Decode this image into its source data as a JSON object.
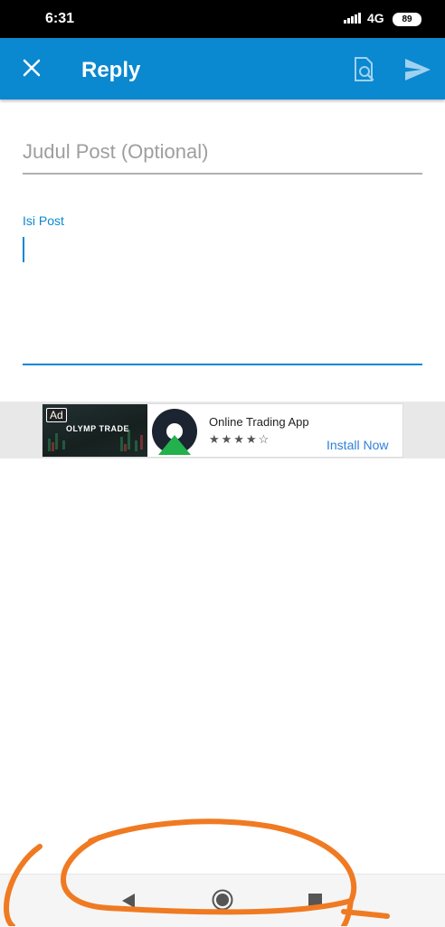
{
  "status_bar": {
    "time": "6:31",
    "network": "4G",
    "battery": "89"
  },
  "app_bar": {
    "title": "Reply",
    "close_icon": "close-icon",
    "preview_icon": "document-search-icon",
    "send_icon": "send-icon"
  },
  "form": {
    "title_placeholder": "Judul Post (Optional)",
    "title_value": "",
    "body_label": "Isi Post",
    "body_value": ""
  },
  "ad": {
    "badge": "Ad",
    "image_brand": "OLYMP TRADE",
    "app_name": "Online Trading App",
    "stars": "★★★★☆",
    "cta": "Install Now"
  },
  "nav_bar": {
    "back_icon": "back-triangle-icon",
    "home_icon": "home-circle-icon",
    "recents_icon": "recents-square-icon"
  },
  "colors": {
    "primary": "#0a88d0",
    "annotation": "#f07a22"
  }
}
